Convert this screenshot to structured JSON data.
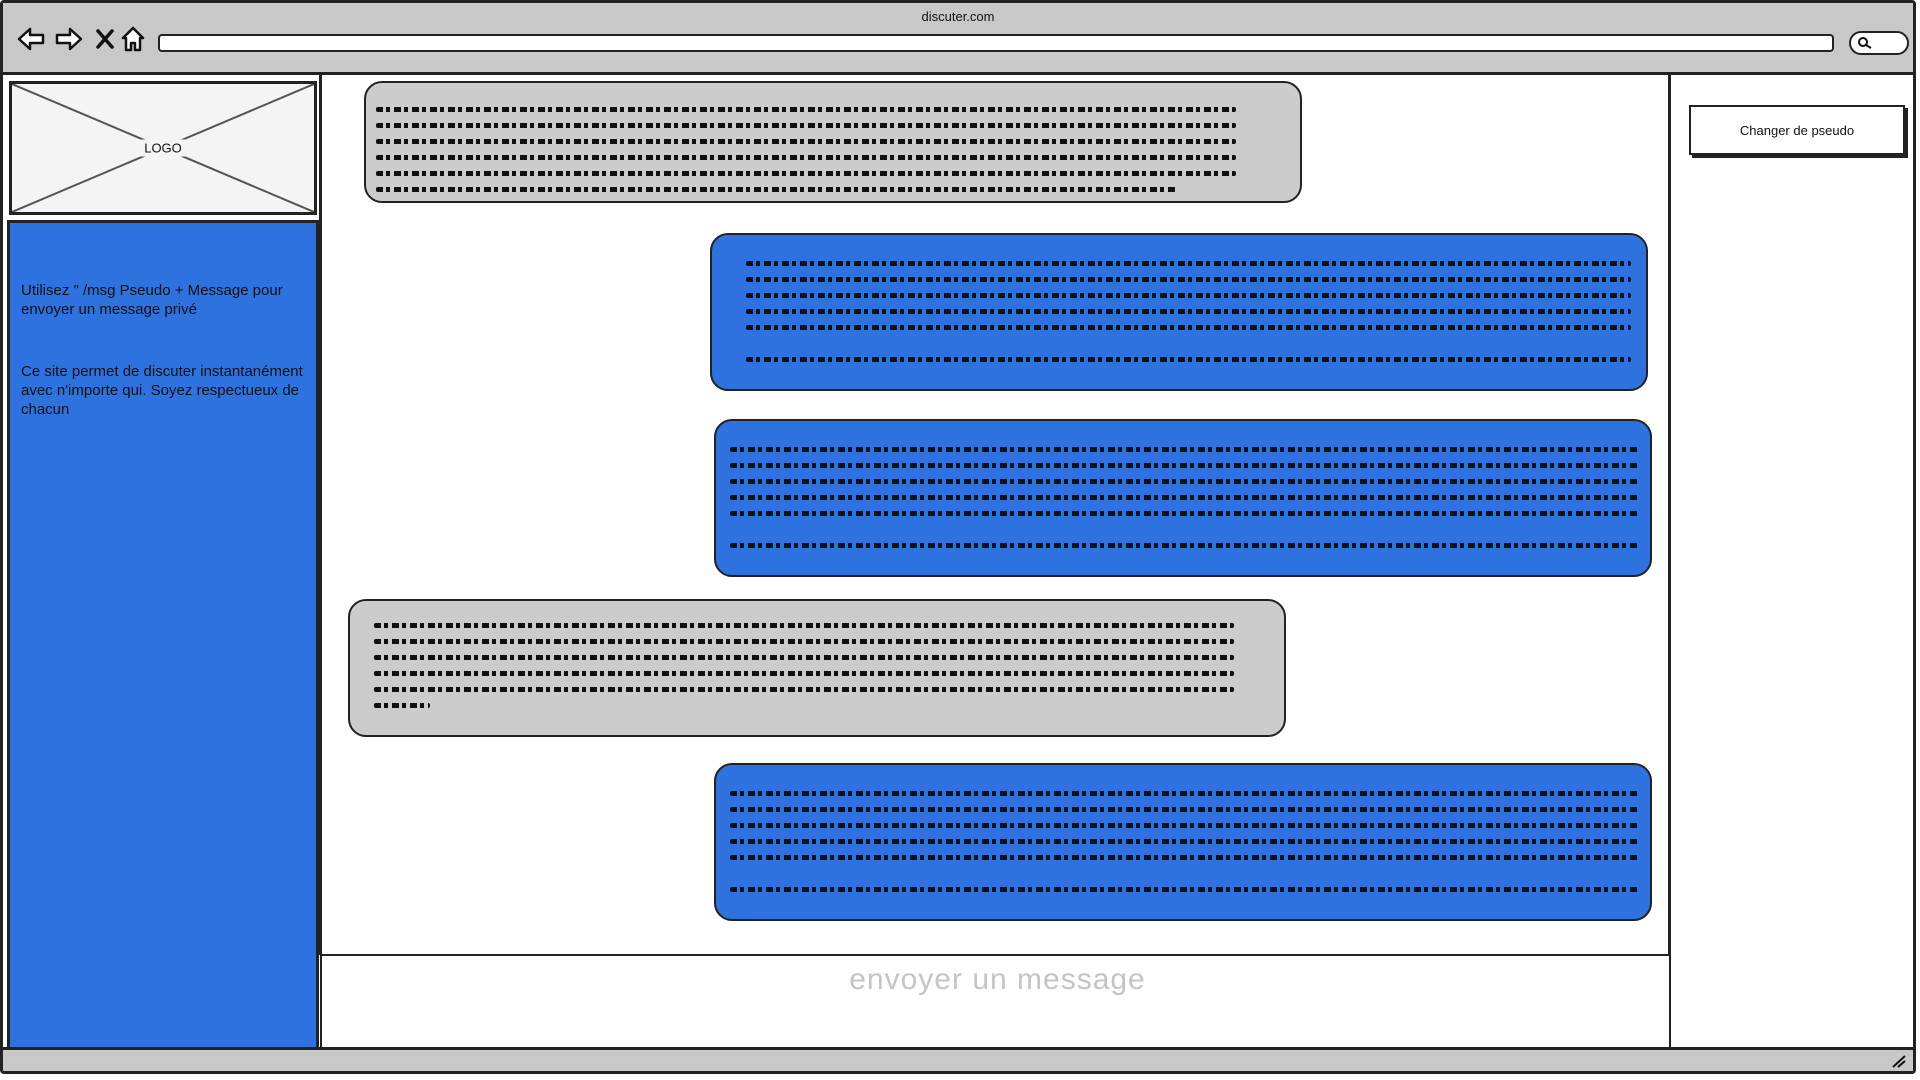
{
  "browser": {
    "title": "discuter.com",
    "icons": [
      "back-arrow-icon",
      "forward-arrow-icon",
      "close-icon",
      "home-icon",
      "search-icon"
    ]
  },
  "sidebar": {
    "logo_label": "LOGO",
    "help_text": "Utilisez \" /msg Pseudo + Message pour envoyer un message privé",
    "about_text": "Ce site permet de discuter instantanément avec n'importe qui. Soyez respectueux de chacun"
  },
  "chat": {
    "messages": [
      {
        "side": "left",
        "color": "#cccccc",
        "lines": 6
      },
      {
        "side": "right",
        "color": "#2e72e0",
        "lines": 6
      },
      {
        "side": "right",
        "color": "#2e72e0",
        "lines": 6
      },
      {
        "side": "left",
        "color": "#cccccc",
        "lines": 6
      },
      {
        "side": "right",
        "color": "#2e72e0",
        "lines": 6
      }
    ],
    "input_placeholder": "envoyer un message"
  },
  "right_panel": {
    "change_pseudo_label": "Changer de pseudo"
  },
  "colors": {
    "accent_blue": "#2e72e0",
    "bubble_grey": "#cccccc",
    "chrome_grey": "#c8c8c8"
  }
}
